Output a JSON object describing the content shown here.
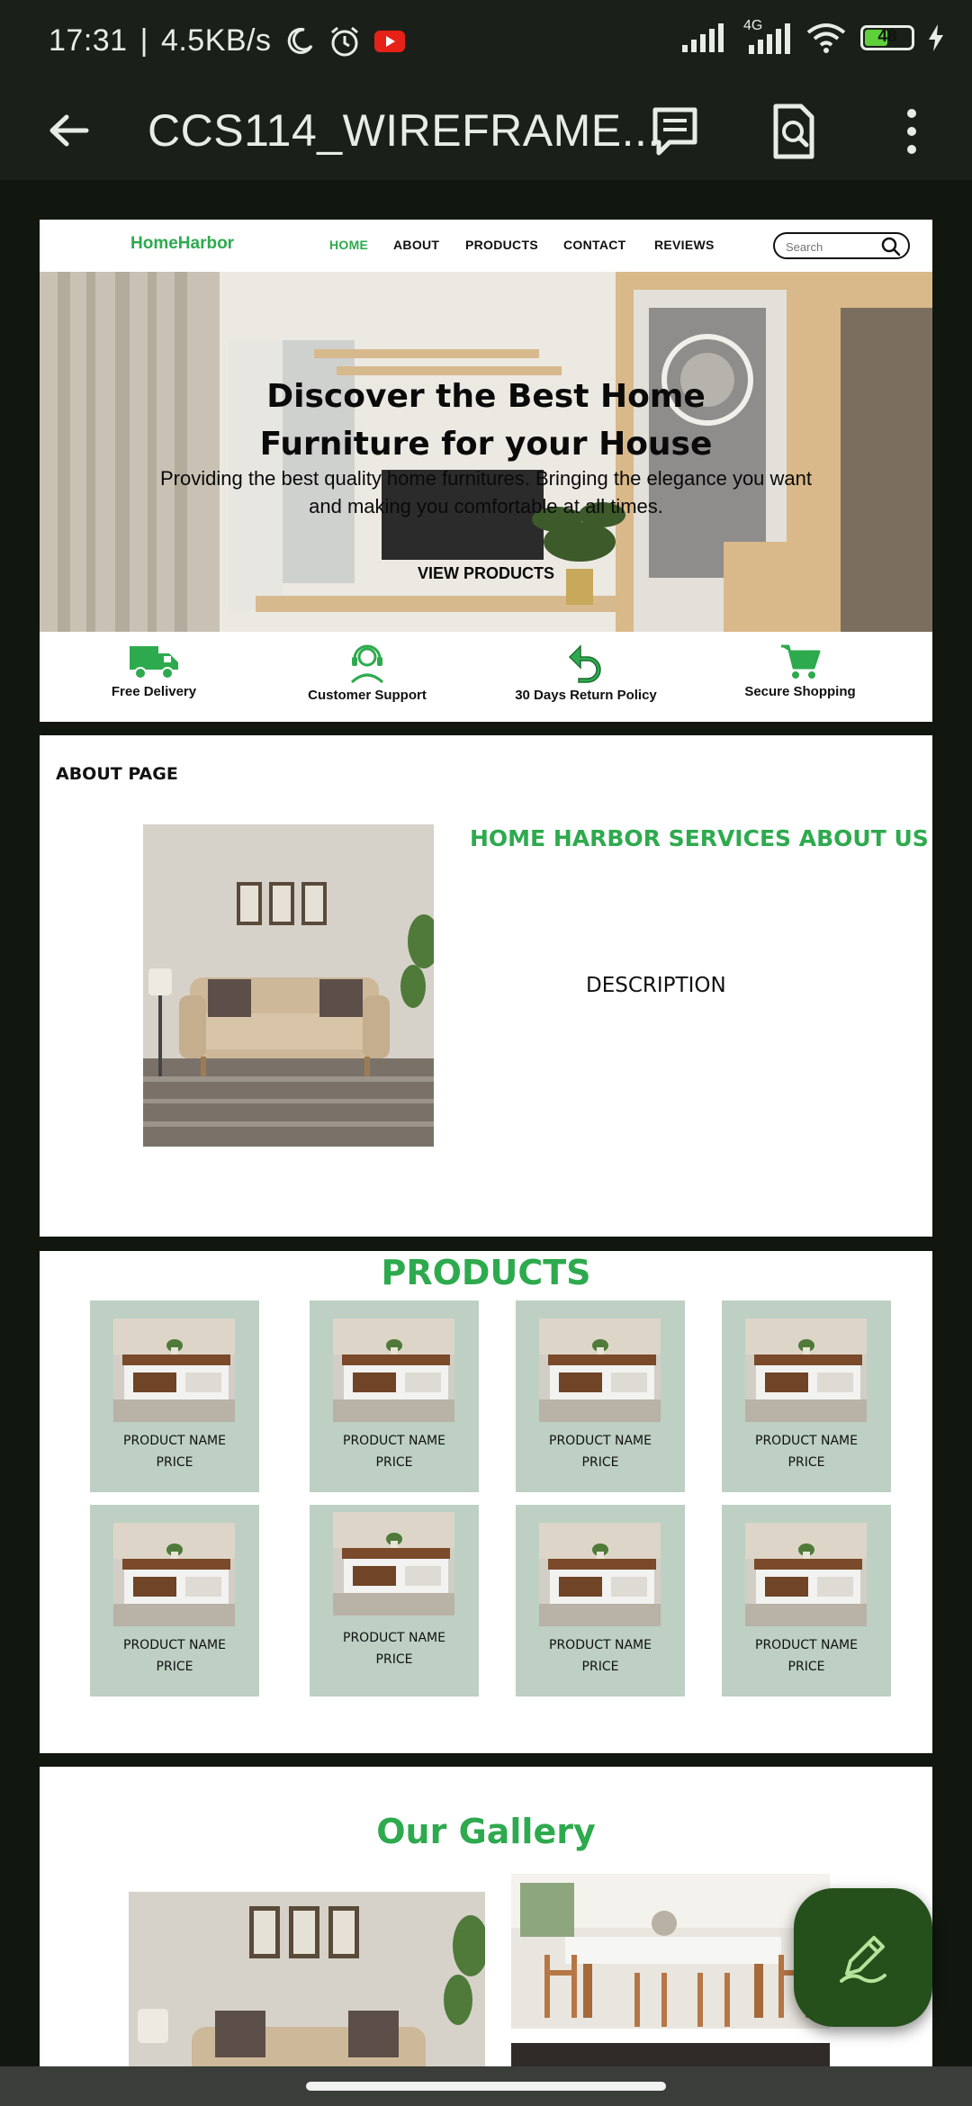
{
  "status_bar": {
    "time": "17:31",
    "speed": "4.5KB/s",
    "network": "4G",
    "battery": "48",
    "battery_level": 0.48
  },
  "toolbar": {
    "title": "CCS114_WIREFRAME...",
    "icons": [
      "back-arrow-icon",
      "comment-icon",
      "search-document-icon",
      "more-icon"
    ]
  },
  "site": {
    "brand": "HomeHarbor",
    "nav": [
      "HOME",
      "ABOUT",
      "PRODUCTS",
      "CONTACT",
      "REVIEWS"
    ],
    "search_placeholder": "Search",
    "hero": {
      "title_line1": "Discover the Best Home",
      "title_line2": "Furniture for your House",
      "subtitle_line1": "Providing the best quality home furnitures. Bringing the elegance you want",
      "subtitle_line2": "and making you comfortable at all times.",
      "button": "VIEW PRODUCTS"
    },
    "features": [
      "Free Delivery",
      "Customer Support",
      "30 Days Return Policy",
      "Secure Shopping"
    ],
    "about": {
      "section_label": "ABOUT PAGE",
      "heading": "HOME HARBOR SERVICES ABOUT US",
      "description": "DESCRIPTION"
    },
    "products": {
      "title": "PRODUCTS",
      "items": [
        {
          "name": "PRODUCT NAME",
          "price": "PRICE"
        },
        {
          "name": "PRODUCT NAME",
          "price": "PRICE"
        },
        {
          "name": "PRODUCT NAME",
          "price": "PRICE"
        },
        {
          "name": "PRODUCT NAME",
          "price": "PRICE"
        },
        {
          "name": "PRODUCT NAME",
          "price": "PRICE"
        },
        {
          "name": "PRODUCT NAME",
          "price": "PRICE"
        },
        {
          "name": "PRODUCT NAME",
          "price": "PRICE"
        },
        {
          "name": "PRODUCT NAME",
          "price": "PRICE"
        }
      ]
    },
    "gallery": {
      "title": "Our Gallery"
    }
  },
  "colors": {
    "accent": "#2eaa4e",
    "product_card": "#bdd0c3",
    "app_bar": "#1a2019",
    "fab": "#25501c"
  }
}
